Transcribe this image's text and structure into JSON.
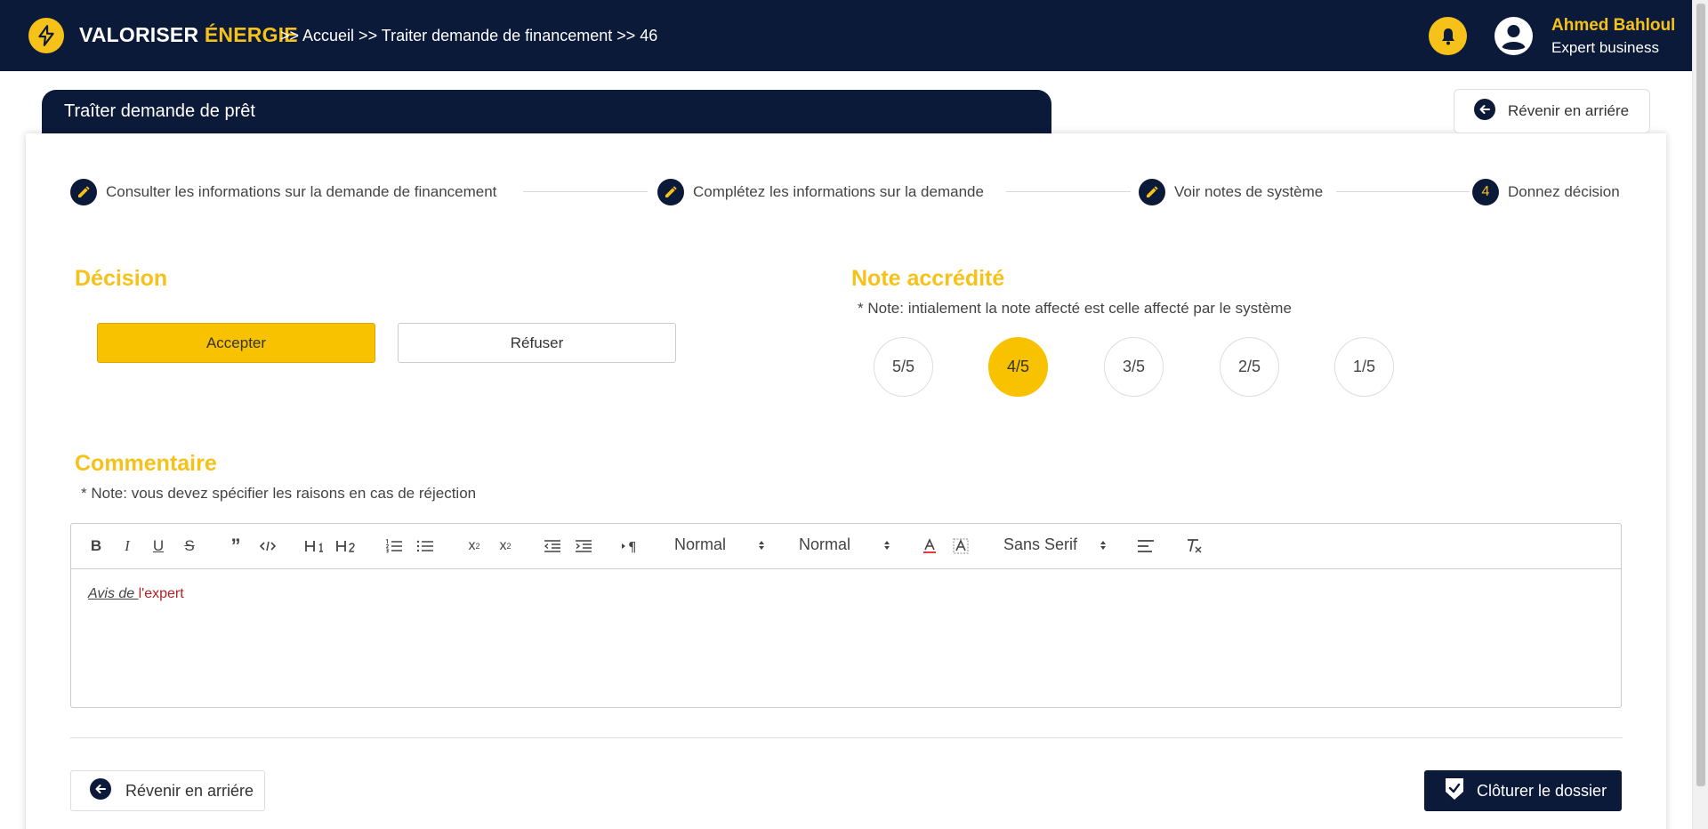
{
  "header": {
    "brand_main": "VALORISER",
    "brand_accent": "ÉNERGIE",
    "breadcrumb": ">> Accueil >> Traiter demande de financement >> 46",
    "user_name": "Ahmed Bahloul",
    "user_role": "Expert business"
  },
  "page": {
    "title": "Traîter demande de prêt",
    "back_label": "Révenir en arriére"
  },
  "stepper": {
    "steps": [
      {
        "label": "Consulter les informations sur la demande de financement",
        "icon": "pencil-icon"
      },
      {
        "label": "Complétez les informations sur la demande",
        "icon": "pencil-icon"
      },
      {
        "label": "Voir notes de système",
        "icon": "pencil-icon"
      },
      {
        "label": "Donnez décision",
        "number": "4"
      }
    ]
  },
  "decision": {
    "title": "Décision",
    "accept_label": "Accepter",
    "refuse_label": "Réfuser",
    "selected": "Accepter"
  },
  "rating": {
    "title": "Note accrédité",
    "note": "* Note: intialement la note affecté est celle affecté par le système",
    "options": [
      "5/5",
      "4/5",
      "3/5",
      "2/5",
      "1/5"
    ],
    "selected": "4/5"
  },
  "comment": {
    "title": "Commentaire",
    "note": "* Note: vous devez spécifier les raisons en cas de réjection",
    "toolbar": {
      "header_select": "Normal",
      "size_select": "Normal",
      "font_select": "Sans Serif"
    },
    "content_part1": "Avis de ",
    "content_part2": "l'expert"
  },
  "footer": {
    "back_label": "Révenir en arriére",
    "close_label": "Clôturer le dossier"
  },
  "colors": {
    "navy": "#0c1a3a",
    "accent": "#f6c21a",
    "accept": "#f8c200"
  }
}
